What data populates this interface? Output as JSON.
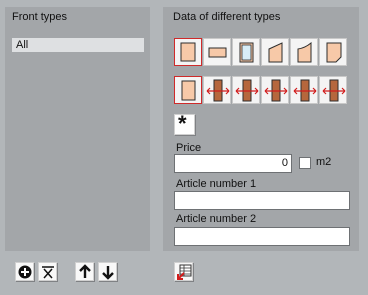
{
  "front_types": {
    "title": "Front types",
    "items": [
      "All"
    ]
  },
  "data_panel": {
    "title": "Data of different types",
    "shape_row_icons": [
      "rectangle-door-icon",
      "horizontal-rect-icon",
      "arched-glass-icon",
      "slanted-top-icon",
      "curved-top-icon",
      "cut-corner-icon"
    ],
    "opening_row_icons": [
      "plain-panel-icon",
      "open-left-right-icon",
      "open-right-left-icon",
      "open-left-right-icon-2",
      "open-right-left-icon-2",
      "open-both-icon"
    ],
    "star_label": "*",
    "price_label": "Price",
    "price_value": "0",
    "m2_label": "m2",
    "article1_label": "Article number 1",
    "article1_value": "",
    "article2_label": "Article number 2",
    "article2_value": ""
  },
  "colors": {
    "background": "#b2b6b9",
    "panel": "#a3a6a9",
    "panel_fill": "#f7c9a8",
    "selected_border": "#cf2a2a",
    "arrow": "#d11c1c"
  }
}
